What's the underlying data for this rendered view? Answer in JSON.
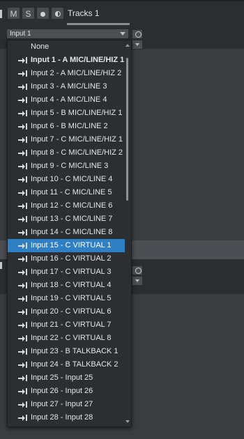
{
  "track": {
    "mute_label": "M",
    "solo_label": "S",
    "name": "Tracks 1"
  },
  "input_select": {
    "value": "Input 1"
  },
  "menu": {
    "items": [
      {
        "label": "None",
        "icon": null,
        "bold": false,
        "selected": false
      },
      {
        "label": "Input 1 - A MIC/LINE/HIZ 1",
        "icon": "input-icon",
        "bold": true,
        "selected": false
      },
      {
        "label": "Input 2 - A MIC/LINE/HIZ 2",
        "icon": "input-icon",
        "bold": false,
        "selected": false
      },
      {
        "label": "Input 3 - A MIC/LINE 3",
        "icon": "input-icon",
        "bold": false,
        "selected": false
      },
      {
        "label": "Input 4 - A MIC/LINE 4",
        "icon": "input-icon",
        "bold": false,
        "selected": false
      },
      {
        "label": "Input 5 - B MIC/LINE/HIZ 1",
        "icon": "input-icon",
        "bold": false,
        "selected": false
      },
      {
        "label": "Input 6 - B MIC/LINE 2",
        "icon": "input-icon",
        "bold": false,
        "selected": false
      },
      {
        "label": "Input 7 - C MIC/LINE/HIZ 1",
        "icon": "input-icon",
        "bold": false,
        "selected": false
      },
      {
        "label": "Input 8 - C MIC/LINE/HIZ 2",
        "icon": "input-icon",
        "bold": false,
        "selected": false
      },
      {
        "label": "Input 9 - C MIC/LINE 3",
        "icon": "input-icon",
        "bold": false,
        "selected": false
      },
      {
        "label": "Input 10 - C MIC/LINE 4",
        "icon": "input-icon",
        "bold": false,
        "selected": false
      },
      {
        "label": "Input 11 - C MIC/LINE 5",
        "icon": "input-icon",
        "bold": false,
        "selected": false
      },
      {
        "label": "Input 12 - C MIC/LINE 6",
        "icon": "input-icon",
        "bold": false,
        "selected": false
      },
      {
        "label": "Input 13 - C MIC/LINE 7",
        "icon": "input-icon",
        "bold": false,
        "selected": false
      },
      {
        "label": "Input 14 - C MIC/LINE 8",
        "icon": "input-icon",
        "bold": false,
        "selected": false
      },
      {
        "label": "Input 15 - C VIRTUAL 1",
        "icon": "input-icon",
        "bold": false,
        "selected": true
      },
      {
        "label": "Input 16 - C VIRTUAL 2",
        "icon": "input-icon",
        "bold": false,
        "selected": false
      },
      {
        "label": "Input 17 - C VIRTUAL 3",
        "icon": "input-icon",
        "bold": false,
        "selected": false
      },
      {
        "label": "Input 18 - C VIRTUAL 4",
        "icon": "input-icon",
        "bold": false,
        "selected": false
      },
      {
        "label": "Input 19 - C VIRTUAL 5",
        "icon": "input-icon",
        "bold": false,
        "selected": false
      },
      {
        "label": "Input 20 - C VIRTUAL 6",
        "icon": "input-icon",
        "bold": false,
        "selected": false
      },
      {
        "label": "Input 21 - C VIRTUAL 7",
        "icon": "input-icon",
        "bold": false,
        "selected": false
      },
      {
        "label": "Input 22 - C VIRTUAL 8",
        "icon": "input-icon",
        "bold": false,
        "selected": false
      },
      {
        "label": "Input 23 - B TALKBACK 1",
        "icon": "input-icon",
        "bold": false,
        "selected": false
      },
      {
        "label": "Input 24 - B TALKBACK 2",
        "icon": "input-icon",
        "bold": false,
        "selected": false
      },
      {
        "label": "Input 25 - Input 25",
        "icon": "input-icon",
        "bold": false,
        "selected": false
      },
      {
        "label": "Input 26 - Input 26",
        "icon": "input-icon",
        "bold": false,
        "selected": false
      },
      {
        "label": "Input 27 - Input 27",
        "icon": "input-icon",
        "bold": false,
        "selected": false
      },
      {
        "label": "Input 28 - Input 28",
        "icon": "input-icon",
        "bold": false,
        "selected": false
      }
    ]
  },
  "colors": {
    "selection": "#2f7fc4",
    "menu_bg": "#2c2f32",
    "panel_bg": "#3a3d40"
  }
}
